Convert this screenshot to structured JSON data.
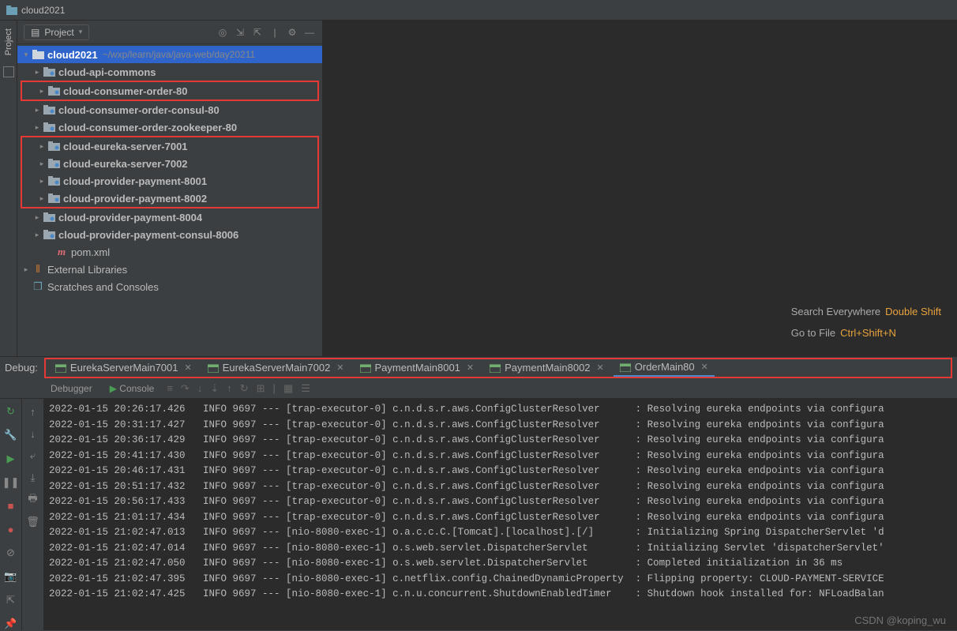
{
  "title": "cloud2021",
  "projectPanel": {
    "label": "Project"
  },
  "tree": {
    "root": {
      "name": "cloud2021",
      "path": "~/wxp/learn/java/java-web/day20211"
    },
    "items": [
      {
        "name": "cloud-api-commons",
        "bold": true
      },
      {
        "name": "cloud-consumer-order-80",
        "bold": true,
        "box": 1
      },
      {
        "name": "cloud-consumer-order-consul-80",
        "bold": true
      },
      {
        "name": "cloud-consumer-order-zookeeper-80",
        "bold": true
      },
      {
        "name": "cloud-eureka-server-7001",
        "bold": true,
        "box": 2
      },
      {
        "name": "cloud-eureka-server-7002",
        "bold": true,
        "box": 2
      },
      {
        "name": "cloud-provider-payment-8001",
        "bold": true,
        "box": 2
      },
      {
        "name": "cloud-provider-payment-8002",
        "bold": true,
        "box": 2
      },
      {
        "name": "cloud-provider-payment-8004",
        "bold": true
      },
      {
        "name": "cloud-provider-payment-consul-8006",
        "bold": true
      },
      {
        "name": "pom.xml",
        "type": "file"
      }
    ],
    "ext1": "External Libraries",
    "ext2": "Scratches and Consoles"
  },
  "hints": {
    "l1a": "Search Everywhere",
    "l1b": "Double Shift",
    "l2a": "Go to File",
    "l2b": "Ctrl+Shift+N"
  },
  "debugLabel": "Debug:",
  "runTabs": [
    {
      "label": "EurekaServerMain7001"
    },
    {
      "label": "EurekaServerMain7002"
    },
    {
      "label": "PaymentMain8001"
    },
    {
      "label": "PaymentMain8002"
    },
    {
      "label": "OrderMain80",
      "active": true
    }
  ],
  "toolTabs": {
    "debugger": "Debugger",
    "console": "Console"
  },
  "logs": [
    "2022-01-15 20:26:17.426   INFO 9697 --- [trap-executor-0] c.n.d.s.r.aws.ConfigClusterResolver      : Resolving eureka endpoints via configura",
    "2022-01-15 20:31:17.427   INFO 9697 --- [trap-executor-0] c.n.d.s.r.aws.ConfigClusterResolver      : Resolving eureka endpoints via configura",
    "2022-01-15 20:36:17.429   INFO 9697 --- [trap-executor-0] c.n.d.s.r.aws.ConfigClusterResolver      : Resolving eureka endpoints via configura",
    "2022-01-15 20:41:17.430   INFO 9697 --- [trap-executor-0] c.n.d.s.r.aws.ConfigClusterResolver      : Resolving eureka endpoints via configura",
    "2022-01-15 20:46:17.431   INFO 9697 --- [trap-executor-0] c.n.d.s.r.aws.ConfigClusterResolver      : Resolving eureka endpoints via configura",
    "2022-01-15 20:51:17.432   INFO 9697 --- [trap-executor-0] c.n.d.s.r.aws.ConfigClusterResolver      : Resolving eureka endpoints via configura",
    "2022-01-15 20:56:17.433   INFO 9697 --- [trap-executor-0] c.n.d.s.r.aws.ConfigClusterResolver      : Resolving eureka endpoints via configura",
    "2022-01-15 21:01:17.434   INFO 9697 --- [trap-executor-0] c.n.d.s.r.aws.ConfigClusterResolver      : Resolving eureka endpoints via configura",
    "2022-01-15 21:02:47.013   INFO 9697 --- [nio-8080-exec-1] o.a.c.c.C.[Tomcat].[localhost].[/]       : Initializing Spring DispatcherServlet 'd",
    "2022-01-15 21:02:47.014   INFO 9697 --- [nio-8080-exec-1] o.s.web.servlet.DispatcherServlet        : Initializing Servlet 'dispatcherServlet'",
    "2022-01-15 21:02:47.050   INFO 9697 --- [nio-8080-exec-1] o.s.web.servlet.DispatcherServlet        : Completed initialization in 36 ms",
    "2022-01-15 21:02:47.395   INFO 9697 --- [nio-8080-exec-1] c.netflix.config.ChainedDynamicProperty  : Flipping property: CLOUD-PAYMENT-SERVICE",
    "2022-01-15 21:02:47.425   INFO 9697 --- [nio-8080-exec-1] c.n.u.concurrent.ShutdownEnabledTimer    : Shutdown hook installed for: NFLoadBalan"
  ],
  "watermark": "CSDN @koping_wu"
}
